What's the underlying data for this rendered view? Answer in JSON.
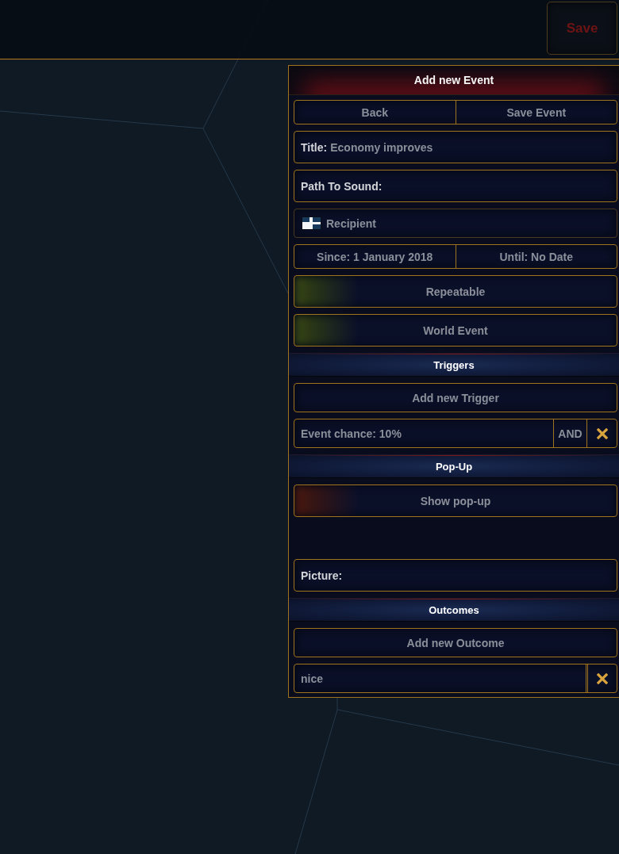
{
  "top_bar": {
    "save_button": "Save"
  },
  "event_panel": {
    "title": "Add new Event",
    "sections": [
      {
        "rows": [
          {
            "kind": "actions",
            "buttons": [
              "Back",
              "Save Event"
            ]
          },
          {
            "kind": "field",
            "label": "Title:",
            "value": "Economy improves"
          },
          {
            "kind": "field",
            "label": "Path To Sound:"
          },
          {
            "kind": "recipient",
            "label": "Recipient"
          },
          {
            "kind": "dates",
            "buttons": [
              "Since: 1 January 2018",
              "Until: No Date"
            ]
          },
          {
            "kind": "toggle",
            "label": "Repeatable",
            "on": true
          },
          {
            "kind": "toggle",
            "label": "World Event",
            "on": true
          }
        ]
      },
      {
        "title": "Triggers",
        "rows": [
          {
            "kind": "add",
            "label": "Add new Trigger"
          },
          {
            "kind": "item",
            "text": "Event chance: 10%",
            "operator": "AND"
          }
        ]
      },
      {
        "title": "Pop-Up",
        "rows": [
          {
            "kind": "toggle",
            "label": "Show pop-up",
            "on": false
          },
          {
            "kind": "field",
            "label": "Picture:"
          }
        ]
      },
      {
        "title": "Outcomes",
        "rows": [
          {
            "kind": "add",
            "label": "Add new Outcome"
          },
          {
            "kind": "item",
            "text": "nice"
          }
        ]
      }
    ]
  }
}
